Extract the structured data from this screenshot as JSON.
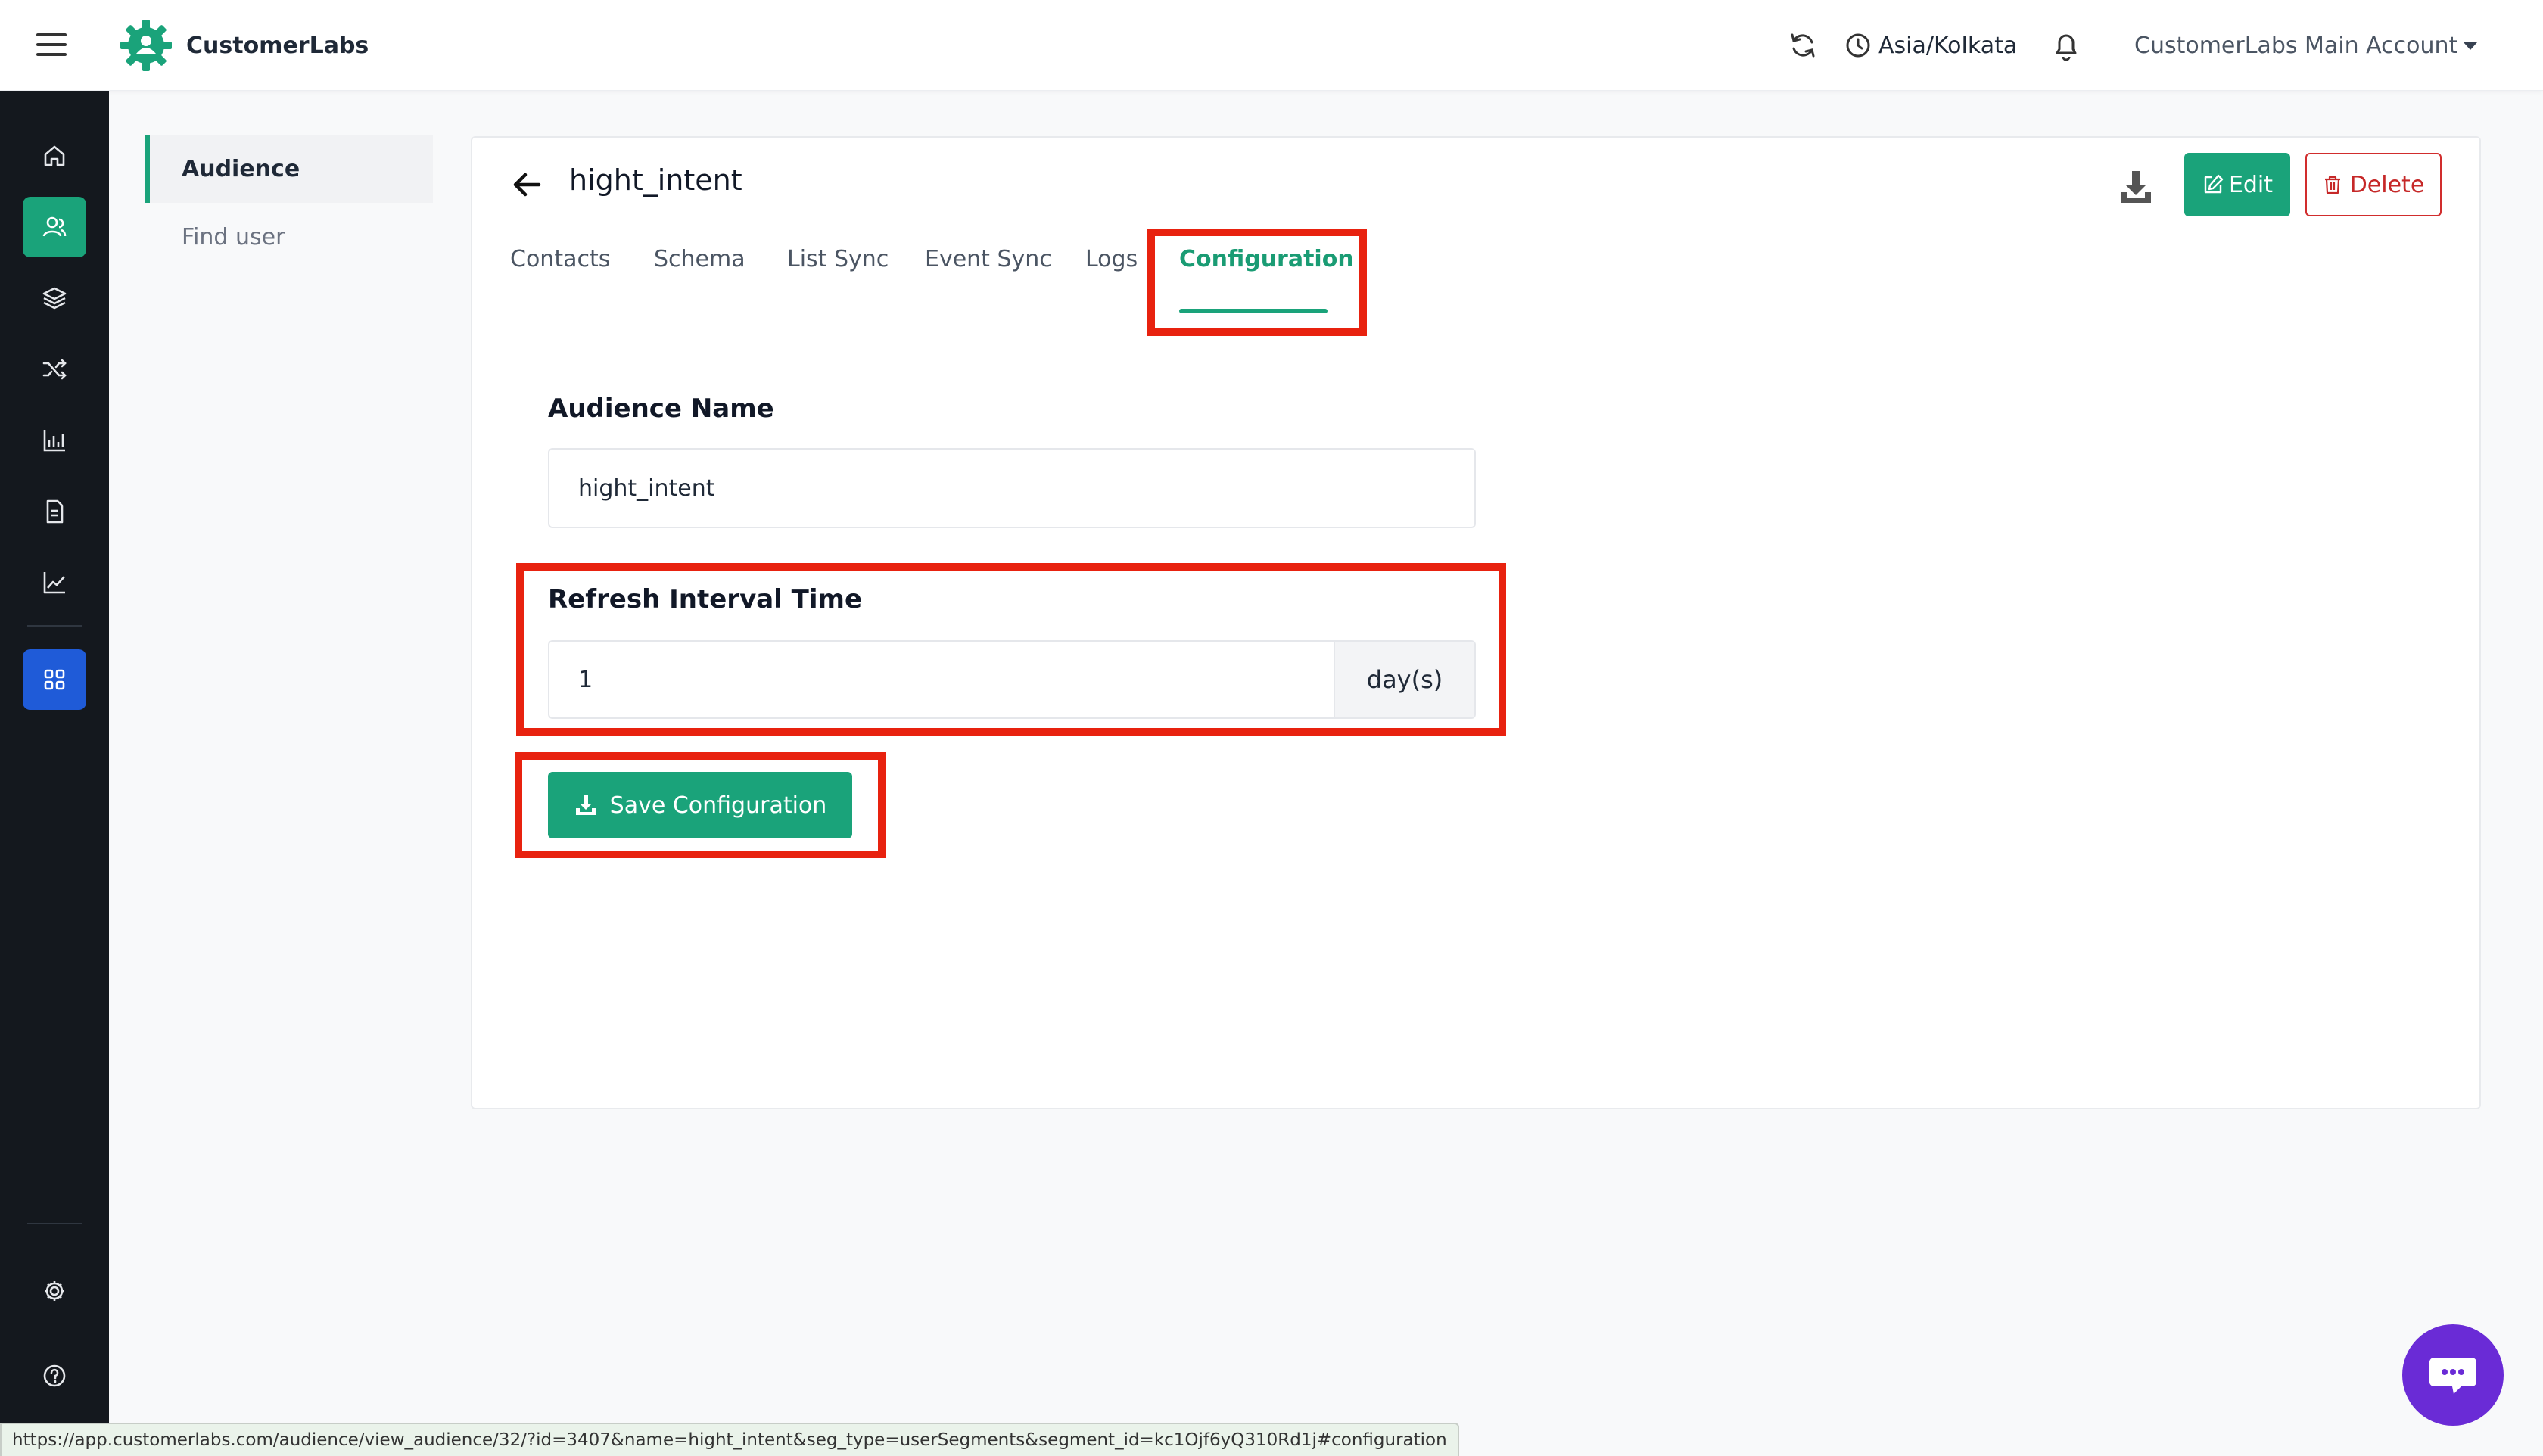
{
  "app": {
    "brand_name": "CustomerLabs",
    "accent_color": "#1aa37a"
  },
  "header": {
    "timezone": "Asia/Kolkata",
    "account_label": "CustomerLabs Main Account",
    "icons": [
      "menu-icon",
      "refresh-icon",
      "clock-icon",
      "bell-icon"
    ]
  },
  "sidebar": {
    "items": [
      {
        "name": "home-icon",
        "active": false
      },
      {
        "name": "audience-icon",
        "active": true
      },
      {
        "name": "layers-icon",
        "active": false
      },
      {
        "name": "shuffle-icon",
        "active": false
      },
      {
        "name": "bar-chart-icon",
        "active": false
      },
      {
        "name": "document-icon",
        "active": false
      },
      {
        "name": "line-chart-icon",
        "active": false
      },
      {
        "name": "apps-grid-icon",
        "active": false
      },
      {
        "name": "settings-icon",
        "active": false
      },
      {
        "name": "help-icon",
        "active": false
      }
    ]
  },
  "subnav": {
    "items": [
      {
        "label": "Audience",
        "active": true
      },
      {
        "label": "Find user",
        "active": false
      }
    ]
  },
  "page": {
    "title": "hight_intent",
    "edit_label": "Edit",
    "delete_label": "Delete"
  },
  "tabs": [
    {
      "label": "Contacts",
      "active": false
    },
    {
      "label": "Schema",
      "active": false
    },
    {
      "label": "List Sync",
      "active": false
    },
    {
      "label": "Event Sync",
      "active": false
    },
    {
      "label": "Logs",
      "active": false
    },
    {
      "label": "Configuration",
      "active": true
    }
  ],
  "form": {
    "audience_name_label": "Audience Name",
    "audience_name_value": "hight_intent",
    "refresh_label": "Refresh Interval Time",
    "refresh_value": "1",
    "refresh_unit": "day(s)",
    "save_label": "Save Configuration"
  },
  "status_url": "https://app.customerlabs.com/audience/view_audience/32/?id=3407&name=hight_intent&seg_type=userSegments&segment_id=kc1Ojf6yQ310Rd1j#configuration"
}
